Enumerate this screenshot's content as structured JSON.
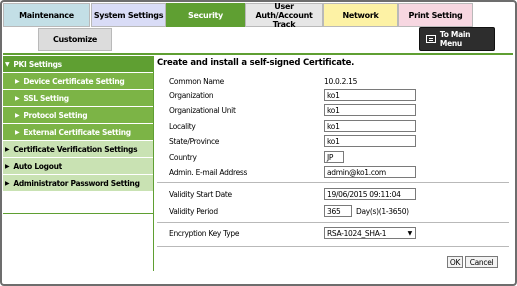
{
  "tabs": {
    "maintenance": "Maintenance",
    "system_settings": "System Settings",
    "security": "Security",
    "user_auth": "User Auth/Account Track",
    "network": "Network",
    "print_setting": "Print Setting"
  },
  "subtab": "Customize",
  "main_menu": "To Main Menu",
  "sidebar": {
    "pki_settings": "PKI Settings",
    "items": [
      "Device Certificate Setting",
      "SSL Setting",
      "Protocol Setting",
      "External Certificate Setting"
    ],
    "certificate_verification": "Certificate Verification Settings",
    "auto_logout": "Auto Logout",
    "admin_password": "Administrator Password Setting"
  },
  "form": {
    "heading": "Create and install a self-signed Certificate.",
    "common_name_label": "Common Name",
    "common_name_value": "10.0.2.15",
    "organization_label": "Organization",
    "organization_value": "ko1",
    "org_unit_label": "Organizational Unit",
    "org_unit_value": "ko1",
    "locality_label": "Locality",
    "locality_value": "ko1",
    "state_label": "State/Province",
    "state_value": "ko1",
    "country_label": "Country",
    "country_value": "JP",
    "email_label": "Admin. E-mail Address",
    "email_value": "admin@ko1.com",
    "validity_start_label": "Validity Start Date",
    "validity_start_value": "19/06/2015 09:11:04",
    "validity_period_label": "Validity Period",
    "validity_period_value": "365",
    "validity_period_unit": "Day(s)(1-3650)",
    "encryption_label": "Encryption Key Type",
    "encryption_value": "RSA-1024_SHA-1"
  },
  "buttons": {
    "ok": "OK",
    "cancel": "Cancel"
  },
  "colors": {
    "security_green": "#5f9f32",
    "sidebar_sub_green": "#7cb446",
    "sidebar_light_green": "#c9e2b3",
    "maintenance_tab": "#c3dfe6",
    "system_tab": "#d9dcf6",
    "network_tab": "#fdf2a5",
    "print_tab": "#f7d7e1"
  }
}
